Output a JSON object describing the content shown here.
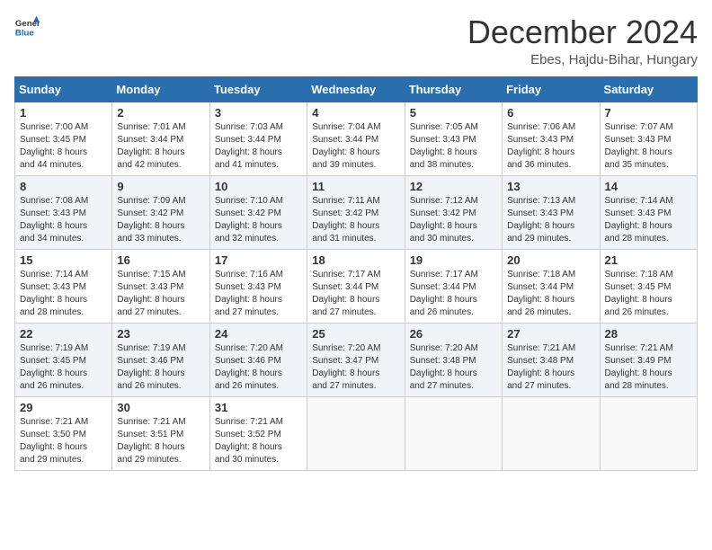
{
  "header": {
    "logo": {
      "text1": "General",
      "text2": "Blue"
    },
    "title": "December 2024",
    "location": "Ebes, Hajdu-Bihar, Hungary"
  },
  "days_of_week": [
    "Sunday",
    "Monday",
    "Tuesday",
    "Wednesday",
    "Thursday",
    "Friday",
    "Saturday"
  ],
  "weeks": [
    [
      {
        "day": 1,
        "lines": [
          "Sunrise: 7:00 AM",
          "Sunset: 3:45 PM",
          "Daylight: 8 hours",
          "and 44 minutes."
        ]
      },
      {
        "day": 2,
        "lines": [
          "Sunrise: 7:01 AM",
          "Sunset: 3:44 PM",
          "Daylight: 8 hours",
          "and 42 minutes."
        ]
      },
      {
        "day": 3,
        "lines": [
          "Sunrise: 7:03 AM",
          "Sunset: 3:44 PM",
          "Daylight: 8 hours",
          "and 41 minutes."
        ]
      },
      {
        "day": 4,
        "lines": [
          "Sunrise: 7:04 AM",
          "Sunset: 3:44 PM",
          "Daylight: 8 hours",
          "and 39 minutes."
        ]
      },
      {
        "day": 5,
        "lines": [
          "Sunrise: 7:05 AM",
          "Sunset: 3:43 PM",
          "Daylight: 8 hours",
          "and 38 minutes."
        ]
      },
      {
        "day": 6,
        "lines": [
          "Sunrise: 7:06 AM",
          "Sunset: 3:43 PM",
          "Daylight: 8 hours",
          "and 36 minutes."
        ]
      },
      {
        "day": 7,
        "lines": [
          "Sunrise: 7:07 AM",
          "Sunset: 3:43 PM",
          "Daylight: 8 hours",
          "and 35 minutes."
        ]
      }
    ],
    [
      {
        "day": 8,
        "lines": [
          "Sunrise: 7:08 AM",
          "Sunset: 3:43 PM",
          "Daylight: 8 hours",
          "and 34 minutes."
        ]
      },
      {
        "day": 9,
        "lines": [
          "Sunrise: 7:09 AM",
          "Sunset: 3:42 PM",
          "Daylight: 8 hours",
          "and 33 minutes."
        ]
      },
      {
        "day": 10,
        "lines": [
          "Sunrise: 7:10 AM",
          "Sunset: 3:42 PM",
          "Daylight: 8 hours",
          "and 32 minutes."
        ]
      },
      {
        "day": 11,
        "lines": [
          "Sunrise: 7:11 AM",
          "Sunset: 3:42 PM",
          "Daylight: 8 hours",
          "and 31 minutes."
        ]
      },
      {
        "day": 12,
        "lines": [
          "Sunrise: 7:12 AM",
          "Sunset: 3:42 PM",
          "Daylight: 8 hours",
          "and 30 minutes."
        ]
      },
      {
        "day": 13,
        "lines": [
          "Sunrise: 7:13 AM",
          "Sunset: 3:43 PM",
          "Daylight: 8 hours",
          "and 29 minutes."
        ]
      },
      {
        "day": 14,
        "lines": [
          "Sunrise: 7:14 AM",
          "Sunset: 3:43 PM",
          "Daylight: 8 hours",
          "and 28 minutes."
        ]
      }
    ],
    [
      {
        "day": 15,
        "lines": [
          "Sunrise: 7:14 AM",
          "Sunset: 3:43 PM",
          "Daylight: 8 hours",
          "and 28 minutes."
        ]
      },
      {
        "day": 16,
        "lines": [
          "Sunrise: 7:15 AM",
          "Sunset: 3:43 PM",
          "Daylight: 8 hours",
          "and 27 minutes."
        ]
      },
      {
        "day": 17,
        "lines": [
          "Sunrise: 7:16 AM",
          "Sunset: 3:43 PM",
          "Daylight: 8 hours",
          "and 27 minutes."
        ]
      },
      {
        "day": 18,
        "lines": [
          "Sunrise: 7:17 AM",
          "Sunset: 3:44 PM",
          "Daylight: 8 hours",
          "and 27 minutes."
        ]
      },
      {
        "day": 19,
        "lines": [
          "Sunrise: 7:17 AM",
          "Sunset: 3:44 PM",
          "Daylight: 8 hours",
          "and 26 minutes."
        ]
      },
      {
        "day": 20,
        "lines": [
          "Sunrise: 7:18 AM",
          "Sunset: 3:44 PM",
          "Daylight: 8 hours",
          "and 26 minutes."
        ]
      },
      {
        "day": 21,
        "lines": [
          "Sunrise: 7:18 AM",
          "Sunset: 3:45 PM",
          "Daylight: 8 hours",
          "and 26 minutes."
        ]
      }
    ],
    [
      {
        "day": 22,
        "lines": [
          "Sunrise: 7:19 AM",
          "Sunset: 3:45 PM",
          "Daylight: 8 hours",
          "and 26 minutes."
        ]
      },
      {
        "day": 23,
        "lines": [
          "Sunrise: 7:19 AM",
          "Sunset: 3:46 PM",
          "Daylight: 8 hours",
          "and 26 minutes."
        ]
      },
      {
        "day": 24,
        "lines": [
          "Sunrise: 7:20 AM",
          "Sunset: 3:46 PM",
          "Daylight: 8 hours",
          "and 26 minutes."
        ]
      },
      {
        "day": 25,
        "lines": [
          "Sunrise: 7:20 AM",
          "Sunset: 3:47 PM",
          "Daylight: 8 hours",
          "and 27 minutes."
        ]
      },
      {
        "day": 26,
        "lines": [
          "Sunrise: 7:20 AM",
          "Sunset: 3:48 PM",
          "Daylight: 8 hours",
          "and 27 minutes."
        ]
      },
      {
        "day": 27,
        "lines": [
          "Sunrise: 7:21 AM",
          "Sunset: 3:48 PM",
          "Daylight: 8 hours",
          "and 27 minutes."
        ]
      },
      {
        "day": 28,
        "lines": [
          "Sunrise: 7:21 AM",
          "Sunset: 3:49 PM",
          "Daylight: 8 hours",
          "and 28 minutes."
        ]
      }
    ],
    [
      {
        "day": 29,
        "lines": [
          "Sunrise: 7:21 AM",
          "Sunset: 3:50 PM",
          "Daylight: 8 hours",
          "and 29 minutes."
        ]
      },
      {
        "day": 30,
        "lines": [
          "Sunrise: 7:21 AM",
          "Sunset: 3:51 PM",
          "Daylight: 8 hours",
          "and 29 minutes."
        ]
      },
      {
        "day": 31,
        "lines": [
          "Sunrise: 7:21 AM",
          "Sunset: 3:52 PM",
          "Daylight: 8 hours",
          "and 30 minutes."
        ]
      },
      null,
      null,
      null,
      null
    ]
  ]
}
